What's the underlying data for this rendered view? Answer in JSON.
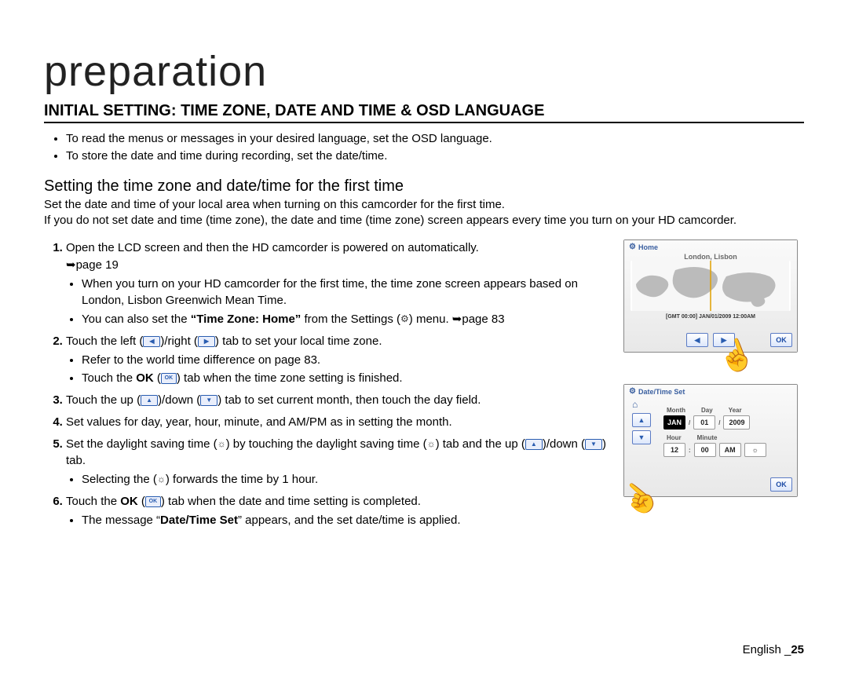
{
  "title": "preparation",
  "section_heading": "INITIAL SETTING: TIME ZONE, DATE AND TIME & OSD LANGUAGE",
  "top_bullets": [
    "To read the menus or messages in your desired language, set the OSD language.",
    "To store the date and time during recording, set the date/time."
  ],
  "sub_heading": "Setting the time zone and date/time for the first time",
  "sub_desc": "Set the date and time of your local area when turning on this camcorder for the first time.\nIf you do not set date and time (time zone), the date and time (time zone) screen appears every time you turn on your HD camcorder.",
  "steps": {
    "s1": {
      "text_a": "Open the LCD screen and then the HD camcorder is powered on automatically.",
      "text_b": "➥page 19",
      "sub": [
        "When you turn on your HD camcorder for the first time, the time zone screen appears based on London, Lisbon Greenwich Mean Time.",
        "You can also set the “Time Zone: Home” from the Settings ( ⚙ ) menu. ➥page 83"
      ]
    },
    "s2": {
      "text": "Touch the left ( ◀ )/right ( ▶ ) tab to set your local time zone.",
      "sub": [
        "Refer to the world time difference on page 83.",
        "Touch the OK ( OK ) tab when the time zone setting is finished."
      ]
    },
    "s3": "Touch the up ( ▲ )/down ( ▼ ) tab to set current month, then touch the day field.",
    "s4": "Set values for day, year, hour, minute, and AM/PM as in setting the month.",
    "s5": {
      "text": "Set the daylight saving time ( ☼ ) by touching the daylight saving time ( ☼ ) tab and the up ( ▲ )/down ( ▼ ) tab.",
      "sub": [
        "Selecting the ( ☼ ) forwards the time by 1 hour."
      ]
    },
    "s6": {
      "text": "Touch the OK ( OK ) tab when the date and time setting is completed.",
      "sub": [
        "The message “Date/Time Set” appears, and the set date/time is applied."
      ]
    }
  },
  "fig1": {
    "header": "Home",
    "city": "London, Lisbon",
    "gmt": "[GMT 00:00] JAN/01/2009 12:00AM",
    "left": "◀",
    "right": "▶",
    "ok": "OK"
  },
  "fig2": {
    "header": "Date/Time Set",
    "labels_top": {
      "month": "Month",
      "day": "Day",
      "year": "Year"
    },
    "labels_bottom": {
      "hour": "Hour",
      "minute": "Minute"
    },
    "values": {
      "month": "JAN",
      "day": "01",
      "year": "2009",
      "hour": "12",
      "minute": "00",
      "ampm": "AM",
      "dst": "☼"
    },
    "up": "▲",
    "down": "▼",
    "ok": "OK"
  },
  "footer": {
    "lang": "English _",
    "page": "25"
  }
}
